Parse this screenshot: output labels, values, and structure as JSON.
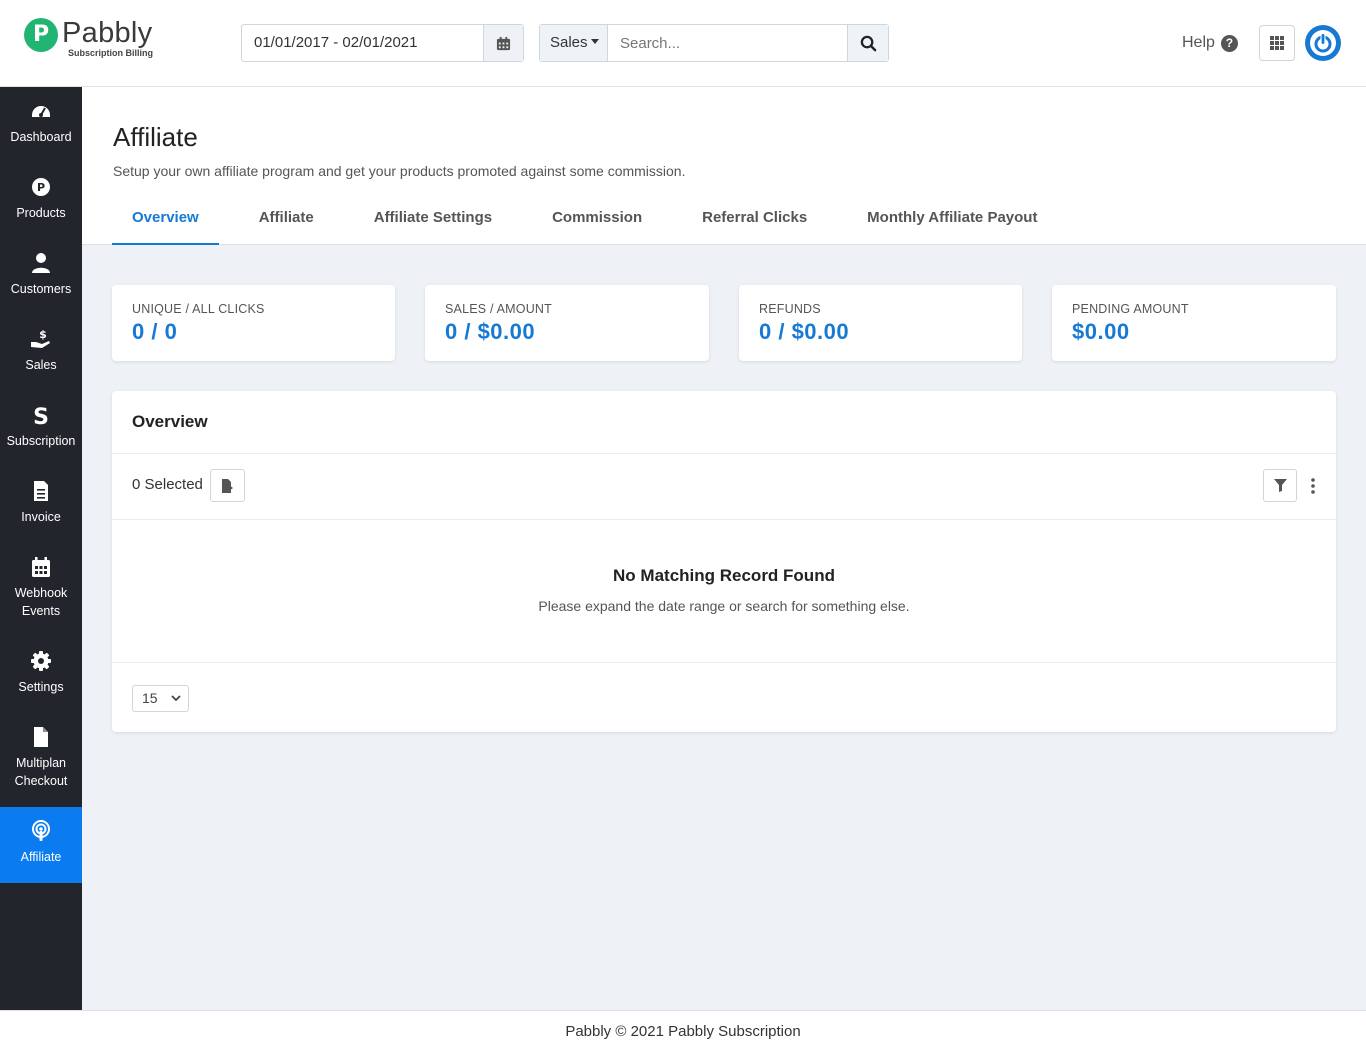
{
  "brand": {
    "name": "Pabbly",
    "tagline": "Subscription Billing",
    "accent": "#1679d4",
    "logo_color": "#21b573"
  },
  "header": {
    "date_range": "01/01/2017 - 02/01/2021",
    "search_scope": "Sales",
    "search_placeholder": "Search...",
    "help_label": "Help",
    "calendar_icon": "calendar-icon",
    "search_icon": "search-icon",
    "apps_icon": "grid-icon",
    "power_icon": "power-icon"
  },
  "sidebar": {
    "bg_color": "#22252b",
    "active_color": "#0a7cf0",
    "items": [
      {
        "label": "Dashboard",
        "icon": "dashboard-icon"
      },
      {
        "label": "Products",
        "icon": "products-icon"
      },
      {
        "label": "Customers",
        "icon": "user-icon"
      },
      {
        "label": "Sales",
        "icon": "sales-icon"
      },
      {
        "label": "Subscription",
        "icon": "subscription-icon"
      },
      {
        "label": "Invoice",
        "icon": "invoice-icon"
      },
      {
        "label": "Webhook",
        "label2": "Events",
        "icon": "calendar-icon"
      },
      {
        "label": "Settings",
        "icon": "gear-icon"
      },
      {
        "label": "Multiplan",
        "label2": "Checkout",
        "icon": "file-icon"
      },
      {
        "label": "Affiliate",
        "icon": "broadcast-icon",
        "active": true
      }
    ]
  },
  "page": {
    "title": "Affiliate",
    "subtitle": "Setup your own affiliate program and get your products promoted against some commission.",
    "tabs": [
      {
        "label": "Overview",
        "active": true
      },
      {
        "label": "Affiliate"
      },
      {
        "label": "Affiliate Settings"
      },
      {
        "label": "Commission"
      },
      {
        "label": "Referral Clicks"
      },
      {
        "label": "Monthly Affiliate Payout"
      }
    ]
  },
  "stats": [
    {
      "label": "UNIQUE / ALL CLICKS",
      "value": "0 / 0"
    },
    {
      "label": "SALES / AMOUNT",
      "value": "0 / $0.00"
    },
    {
      "label": "REFUNDS",
      "value": "0 / $0.00"
    },
    {
      "label": "PENDING AMOUNT",
      "value": "$0.00"
    }
  ],
  "overview": {
    "title": "Overview",
    "selected_text": "0 Selected",
    "empty_title": "No Matching Record Found",
    "empty_subtitle": "Please expand the date range or search for something else.",
    "page_size": "15"
  },
  "footer": {
    "text": "Pabbly © 2021 Pabbly Subscription"
  }
}
